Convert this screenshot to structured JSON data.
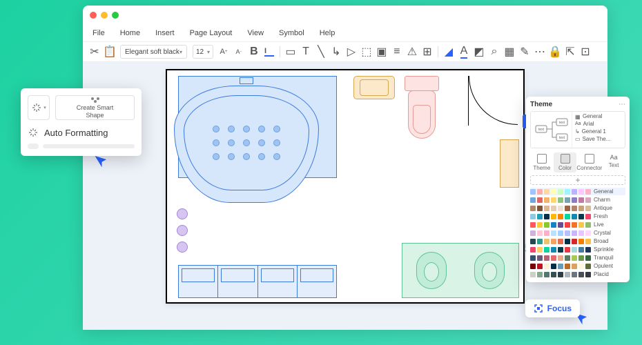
{
  "menu": {
    "file": "File",
    "home": "Home",
    "insert": "Insert",
    "page_layout": "Page Layout",
    "view": "View",
    "symbol": "Symbol",
    "help": "Help"
  },
  "toolbar": {
    "font": "Elegant soft black",
    "size": "12"
  },
  "popup": {
    "create_smart_l1": "Create Smart",
    "create_smart_l2": "Shape",
    "auto_formatting": "Auto Formatting"
  },
  "theme": {
    "title": "Theme",
    "preview": {
      "general": "General",
      "arial": "Arial",
      "general1": "General 1",
      "save": "Save The..."
    },
    "tabs": {
      "theme": "Theme",
      "color": "Color",
      "connector": "Connector",
      "text": "Text"
    },
    "swatches": [
      "General",
      "Charm",
      "Antique",
      "Fresh",
      "Live",
      "Crystal",
      "Broad",
      "Sprinkle",
      "Tranquil",
      "Opulent",
      "Placid"
    ]
  },
  "focus": {
    "label": "Focus"
  },
  "swatch_colors": {
    "0": [
      "#a0c4ff",
      "#ffadad",
      "#ffd6a5",
      "#fdffb6",
      "#caffbf",
      "#9bf6ff",
      "#bdb2ff",
      "#ffc6ff",
      "#ffb3c6"
    ],
    "1": [
      "#6fa8dc",
      "#e06666",
      "#f6b26b",
      "#ffd966",
      "#93c47d",
      "#76a5af",
      "#8e7cc3",
      "#c27ba0",
      "#d5a6bd"
    ],
    "2": [
      "#b08968",
      "#7f5539",
      "#ddb892",
      "#e6ccb2",
      "#ede0d4",
      "#9c6644",
      "#b4846c",
      "#c8a27a",
      "#d6bd98"
    ],
    "3": [
      "#8ecae6",
      "#219ebc",
      "#023047",
      "#ffb703",
      "#fb8500",
      "#06d6a0",
      "#118ab2",
      "#073b4c",
      "#ef476f"
    ],
    "4": [
      "#ff595e",
      "#ffca3a",
      "#8ac926",
      "#1982c4",
      "#6a4c93",
      "#f94144",
      "#f3722c",
      "#f9c74f",
      "#90be6d"
    ],
    "5": [
      "#cdb4db",
      "#ffc8dd",
      "#ffafcc",
      "#bde0fe",
      "#a2d2ff",
      "#b8c0ff",
      "#c8b6ff",
      "#e7c6ff",
      "#ffd6ff"
    ],
    "6": [
      "#264653",
      "#2a9d8f",
      "#e9c46a",
      "#f4a261",
      "#e76f51",
      "#003049",
      "#d62828",
      "#f77f00",
      "#fcbf49"
    ],
    "7": [
      "#ef476f",
      "#ffd166",
      "#06d6a0",
      "#118ab2",
      "#073b4c",
      "#e63946",
      "#a8dadc",
      "#457b9d",
      "#1d3557"
    ],
    "8": [
      "#355070",
      "#6d597a",
      "#b56576",
      "#e56b6f",
      "#eaac8b",
      "#5f7a61",
      "#a7c957",
      "#6a994e",
      "#386641"
    ],
    "9": [
      "#780000",
      "#c1121f",
      "#fdf0d5",
      "#003049",
      "#669bbc",
      "#bc6c25",
      "#dda15e",
      "#fefae0",
      "#606c38"
    ],
    "10": [
      "#cad2c5",
      "#84a98c",
      "#52796f",
      "#354f52",
      "#2f3e46",
      "#adb5bd",
      "#6c757d",
      "#495057",
      "#343a40"
    ]
  }
}
